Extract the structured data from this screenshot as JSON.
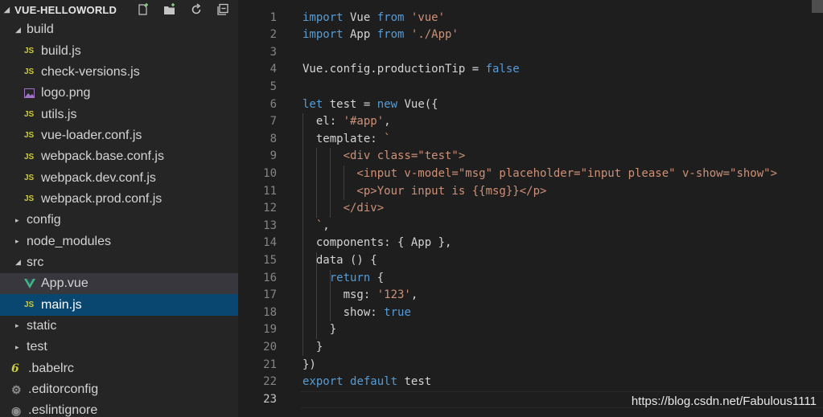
{
  "explorer": {
    "title": "VUE-HELLOWORLD",
    "actions": [
      "new-file-icon",
      "new-folder-icon",
      "refresh-icon",
      "collapse-all-icon"
    ],
    "items": [
      {
        "label": "build",
        "kind": "folder-open",
        "level": 1
      },
      {
        "label": "build.js",
        "kind": "js",
        "level": 2
      },
      {
        "label": "check-versions.js",
        "kind": "js",
        "level": 2
      },
      {
        "label": "logo.png",
        "kind": "image",
        "level": 2
      },
      {
        "label": "utils.js",
        "kind": "js",
        "level": 2
      },
      {
        "label": "vue-loader.conf.js",
        "kind": "js",
        "level": 2
      },
      {
        "label": "webpack.base.conf.js",
        "kind": "js",
        "level": 2
      },
      {
        "label": "webpack.dev.conf.js",
        "kind": "js",
        "level": 2
      },
      {
        "label": "webpack.prod.conf.js",
        "kind": "js",
        "level": 2
      },
      {
        "label": "config",
        "kind": "folder-closed",
        "level": 1
      },
      {
        "label": "node_modules",
        "kind": "folder-closed",
        "level": 1
      },
      {
        "label": "src",
        "kind": "folder-open",
        "level": 1
      },
      {
        "label": "App.vue",
        "kind": "vue",
        "level": 2
      },
      {
        "label": "main.js",
        "kind": "js",
        "level": 2
      },
      {
        "label": "static",
        "kind": "folder-closed",
        "level": 1
      },
      {
        "label": "test",
        "kind": "folder-closed",
        "level": 1
      },
      {
        "label": ".babelrc",
        "kind": "babel",
        "level": 1
      },
      {
        "label": ".editorconfig",
        "kind": "gear",
        "level": 1
      },
      {
        "label": ".eslintignore",
        "kind": "gear",
        "level": 1
      }
    ],
    "hovered_item": "App.vue",
    "active_item": "main.js",
    "js_badge": "JS"
  },
  "editor": {
    "current_line": 23,
    "lines": [
      [
        {
          "t": "import",
          "c": "kw2"
        },
        {
          "t": " Vue ",
          "c": "plain"
        },
        {
          "t": "from",
          "c": "kw2"
        },
        {
          "t": " ",
          "c": "plain"
        },
        {
          "t": "'vue'",
          "c": "str"
        }
      ],
      [
        {
          "t": "import",
          "c": "kw2"
        },
        {
          "t": " App ",
          "c": "plain"
        },
        {
          "t": "from",
          "c": "kw2"
        },
        {
          "t": " ",
          "c": "plain"
        },
        {
          "t": "'./App'",
          "c": "str"
        }
      ],
      [],
      [
        {
          "t": "Vue.config.productionTip = ",
          "c": "plain"
        },
        {
          "t": "false",
          "c": "kw"
        }
      ],
      [],
      [
        {
          "t": "let",
          "c": "kw"
        },
        {
          "t": " test = ",
          "c": "plain"
        },
        {
          "t": "new",
          "c": "kw"
        },
        {
          "t": " Vue({",
          "c": "plain"
        }
      ],
      [
        {
          "t": "  el: ",
          "c": "plain"
        },
        {
          "t": "'#app'",
          "c": "str"
        },
        {
          "t": ",",
          "c": "plain"
        }
      ],
      [
        {
          "t": "  template: ",
          "c": "plain"
        },
        {
          "t": "`",
          "c": "str"
        }
      ],
      [
        {
          "t": "      <div class=\"test\">",
          "c": "str"
        }
      ],
      [
        {
          "t": "        <input v-model=\"msg\" placeholder=\"input please\" v-show=\"show\">",
          "c": "str"
        }
      ],
      [
        {
          "t": "        <p>Your input is {{msg}}</p>",
          "c": "str"
        }
      ],
      [
        {
          "t": "      </div>",
          "c": "str"
        }
      ],
      [
        {
          "t": "  `",
          "c": "str"
        },
        {
          "t": ",",
          "c": "plain"
        }
      ],
      [
        {
          "t": "  components: { App },",
          "c": "plain"
        }
      ],
      [
        {
          "t": "  data () {",
          "c": "plain"
        }
      ],
      [
        {
          "t": "    ",
          "c": "plain"
        },
        {
          "t": "return",
          "c": "kw2"
        },
        {
          "t": " {",
          "c": "plain"
        }
      ],
      [
        {
          "t": "      msg: ",
          "c": "plain"
        },
        {
          "t": "'123'",
          "c": "str"
        },
        {
          "t": ",",
          "c": "plain"
        }
      ],
      [
        {
          "t": "      show: ",
          "c": "plain"
        },
        {
          "t": "true",
          "c": "kw"
        }
      ],
      [
        {
          "t": "    }",
          "c": "plain"
        }
      ],
      [
        {
          "t": "  }",
          "c": "plain"
        }
      ],
      [
        {
          "t": "})",
          "c": "plain"
        }
      ],
      [
        {
          "t": "export",
          "c": "kw2"
        },
        {
          "t": " ",
          "c": "plain"
        },
        {
          "t": "default",
          "c": "kw2"
        },
        {
          "t": " test",
          "c": "plain"
        }
      ],
      []
    ]
  },
  "watermark": "https://blog.csdn.net/Fabulous1111",
  "colors": {
    "sidebar_bg": "#252526",
    "editor_bg": "#1e1e1e",
    "active_bg": "#094771",
    "keyword": "#569cd6",
    "control_keyword": "#c586c0",
    "string": "#ce9178",
    "js_icon": "#cbcb41",
    "vue_icon": "#41b883"
  }
}
